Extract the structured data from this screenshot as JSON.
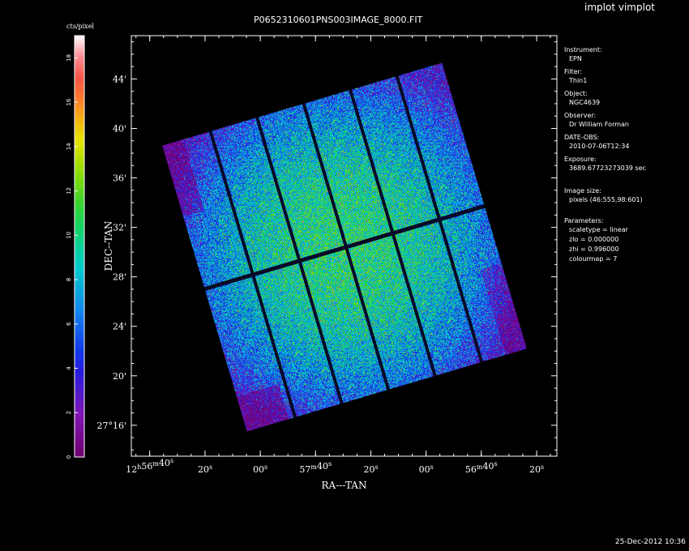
{
  "app_title": "implot vimplot",
  "footer_timestamp": "25-Dec-2012 10:36",
  "chart_data": {
    "type": "heatmap",
    "title": "P0652310601PNS003IMAGE_8000.FIT",
    "xlabel": "RA---TAN",
    "ylabel": "DEC--TAN",
    "x_ticks": [
      {
        "label": "12h56m40s",
        "ra_min": 16.667
      },
      {
        "label": "20s",
        "ra_min": 16.333
      },
      {
        "label": "00s",
        "ra_min": 16.0
      },
      {
        "label": "57m40s",
        "ra_min": 15.667
      },
      {
        "label": "20s",
        "ra_min": 15.333
      },
      {
        "label": "00s",
        "ra_min": 15.0
      },
      {
        "label": "56m40s",
        "ra_min": 14.667
      },
      {
        "label": "20s",
        "ra_min": 14.333
      }
    ],
    "y_ticks": [
      {
        "label": "27°16'",
        "dec_arcmin": 16
      },
      {
        "label": "20'",
        "dec_arcmin": 20
      },
      {
        "label": "24'",
        "dec_arcmin": 24
      },
      {
        "label": "28'",
        "dec_arcmin": 28
      },
      {
        "label": "32'",
        "dec_arcmin": 32
      },
      {
        "label": "36'",
        "dec_arcmin": 36
      },
      {
        "label": "40'",
        "dec_arcmin": 40
      },
      {
        "label": "44'",
        "dec_arcmin": 44
      }
    ],
    "xlim_ra_min": [
      16.778,
      14.211
    ],
    "ylim_dec_arcmin": [
      13.5,
      47.5
    ],
    "colorbar": {
      "label": "cts/pixel",
      "range": [
        0,
        19
      ],
      "ticks": [
        0,
        2,
        4,
        6,
        8,
        10,
        12,
        14,
        16,
        18
      ],
      "colormap": "rainbow (purple-blue-cyan-green-yellow-red-white)"
    },
    "image": {
      "ccd_rows": 2,
      "ccd_columns": 6,
      "rotation_deg": -16.5,
      "mean_level_center": 10,
      "mean_level_edges": 3
    }
  },
  "sidebar": [
    {
      "label": "Instrument:",
      "value": "EPN"
    },
    {
      "label": "Filter:",
      "value": "Thin1"
    },
    {
      "label": "Object:",
      "value": "NGC4639"
    },
    {
      "label": "Observer:",
      "value": "Dr William Forman"
    },
    {
      "label": "DATE-OBS:",
      "value": "2010-07-06T12:34"
    },
    {
      "label": "Exposure:",
      "value": "3689.67723273039 sec"
    },
    {
      "label": "Image size:",
      "value": "pixels (46:555,98:601)"
    },
    {
      "label": "Parameters:",
      "values": [
        "scaletype = linear",
        "zlo = 0.000000",
        "zhi = 0.996000",
        "colourmap =   7"
      ]
    }
  ],
  "colors": {
    "background": "#000000",
    "axes": "#ffffff"
  }
}
